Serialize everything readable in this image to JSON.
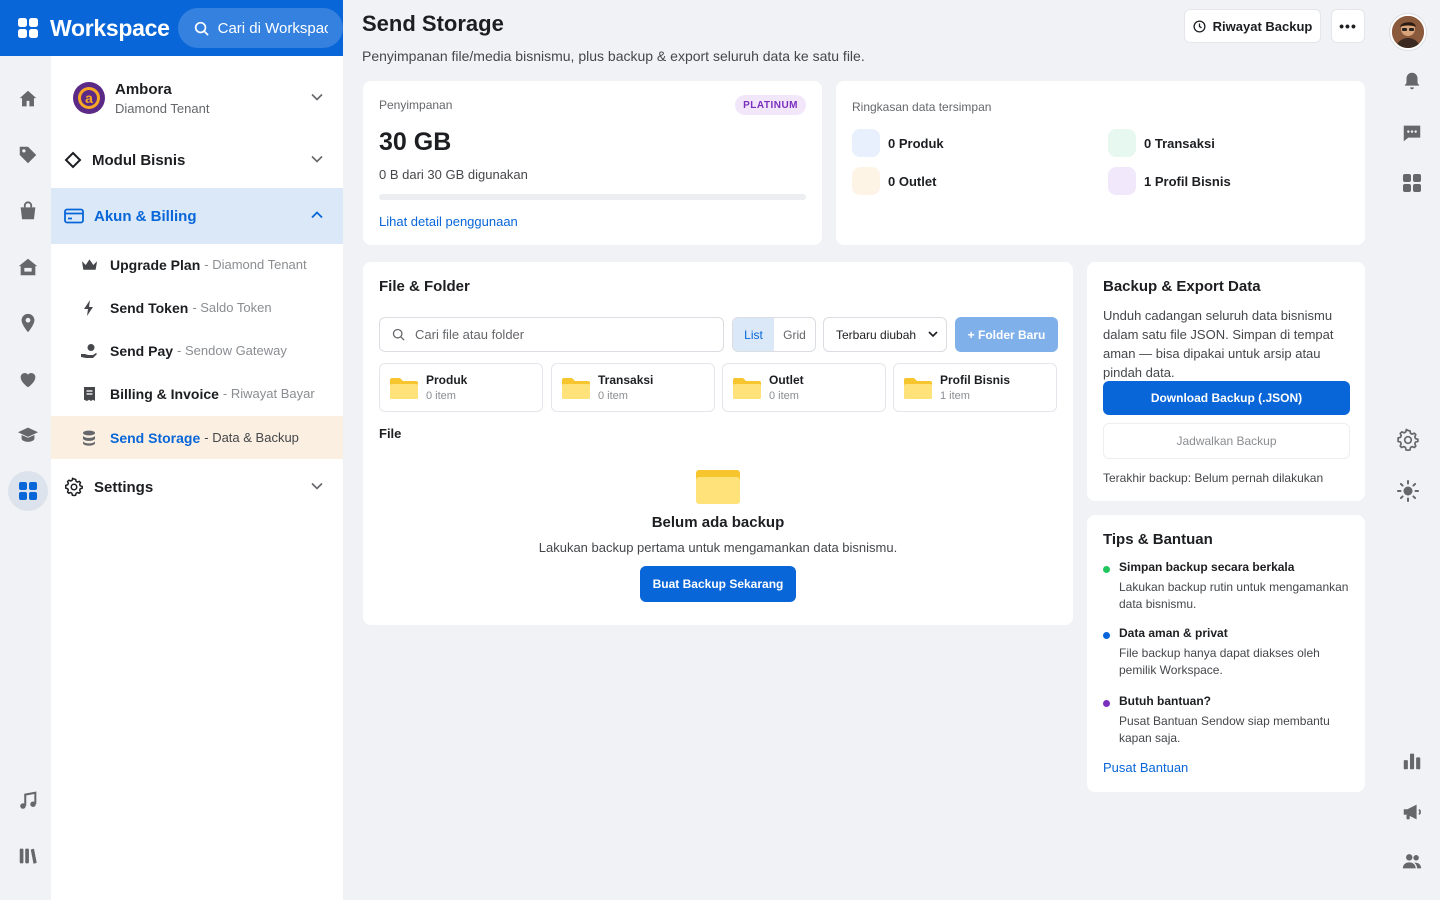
{
  "header": {
    "app_title": "Workspace",
    "search_placeholder": "Cari di Workspace"
  },
  "rail": {
    "icons": [
      "home-icon",
      "tag-icon",
      "shopping-bag-icon",
      "store-icon",
      "location-pin-icon",
      "heart-icon",
      "graduation-cap-icon",
      "apps-grid-icon",
      "music-icon",
      "library-icon"
    ],
    "active": "apps-grid-icon"
  },
  "sidebar": {
    "tenant": {
      "name": "Ambora",
      "plan": "Diamond Tenant"
    },
    "sections": [
      {
        "label": "Modul Bisnis",
        "icon": "diamond-icon"
      },
      {
        "label": "Akun & Billing",
        "icon": "credit-card-icon"
      },
      {
        "label": "Settings",
        "icon": "gear-icon"
      }
    ],
    "items": [
      {
        "title": "Upgrade Plan",
        "desc": "- Diamond Tenant",
        "icon": "crown-icon"
      },
      {
        "title": "Send Token",
        "desc": "- Saldo Token",
        "icon": "lightning-icon"
      },
      {
        "title": "Send Pay",
        "desc": "- Sendow Gateway",
        "icon": "hand-coin-icon"
      },
      {
        "title": "Billing & Invoice",
        "desc": "- Riwayat Bayar",
        "icon": "receipt-icon"
      },
      {
        "title": "Send Storage",
        "desc": "- Data & Backup",
        "icon": "database-icon"
      }
    ]
  },
  "page": {
    "title": "Send Storage",
    "description": "Penyimpanan file/media bisnismu, plus backup & export seluruh data ke satu file.",
    "history_button": "Riwayat Backup",
    "more_button": "•••"
  },
  "storage": {
    "label": "Penyimpanan",
    "plan_badge": "PLATINUM",
    "total": "30 GB",
    "usage_text": "0 B dari 30 GB digunakan",
    "usage_fraction": 0,
    "detail_link": "Lihat detail penggunaan"
  },
  "summary": {
    "title": "Ringkasan data tersimpan",
    "items": [
      {
        "label": "0 Produk",
        "color": "#e7f0fc"
      },
      {
        "label": "0 Transaksi",
        "color": "#e6f8ef"
      },
      {
        "label": "0 Outlet",
        "color": "#fdf4e6"
      },
      {
        "label": "1 Profil Bisnis",
        "color": "#f1e8fb"
      }
    ]
  },
  "files": {
    "title": "File & Folder",
    "search_placeholder": "Cari file atau folder",
    "view_list": "List",
    "view_grid": "Grid",
    "sort_selected": "Terbaru diubah",
    "new_folder_button": "+ Folder Baru",
    "folders": [
      {
        "name": "Produk",
        "count": "0 item"
      },
      {
        "name": "Transaksi",
        "count": "0 item"
      },
      {
        "name": "Outlet",
        "count": "0 item"
      },
      {
        "name": "Profil Bisnis",
        "count": "1 item"
      }
    ],
    "file_heading": "File",
    "empty_title": "Belum ada backup",
    "empty_desc": "Lakukan backup pertama untuk mengamankan data bisnismu.",
    "empty_button": "Buat Backup Sekarang"
  },
  "backup": {
    "title": "Backup & Export Data",
    "description": "Unduh cadangan seluruh data bisnismu dalam satu file JSON. Simpan di tempat aman — bisa dipakai untuk arsip atau pindah data.",
    "download_button": "Download Backup (.JSON)",
    "schedule_button": "Jadwalkan Backup",
    "last_backup": "Terakhir backup: Belum pernah dilakukan"
  },
  "tips": {
    "title": "Tips & Bantuan",
    "items": [
      {
        "title": "Simpan backup secara berkala",
        "body": "Lakukan backup rutin untuk mengamankan data bisnismu.",
        "color": "#22c55e"
      },
      {
        "title": "Data aman & privat",
        "body": "File backup hanya dapat diakses oleh pemilik Workspace.",
        "color": "#0866d8"
      },
      {
        "title": "Butuh bantuan?",
        "body": "Pusat Bantuan Sendow siap membantu kapan saja.",
        "color": "#7b2fbe"
      }
    ],
    "help_link": "Pusat Bantuan"
  },
  "right_rail": {
    "icons": [
      "profile-avatar",
      "bell-icon",
      "chat-icon",
      "apps-grid-icon",
      "gear-icon",
      "sun-icon",
      "bar-chart-icon",
      "megaphone-icon",
      "people-icon"
    ]
  },
  "colors": {
    "primary": "#0866d8",
    "active_nav_bg": "#dbe8f7",
    "active_item_bg": "#fbefe1",
    "folder_yellow": "#ffd44a"
  }
}
